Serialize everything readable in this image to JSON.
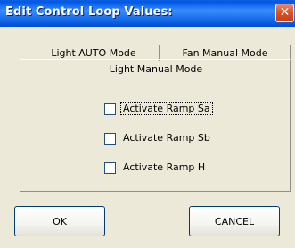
{
  "window": {
    "title": "Edit Control Loop Values:",
    "close_glyph": "✕"
  },
  "tabs": [
    {
      "label": "Light AUTO Mode"
    },
    {
      "label": "Fan Manual Mode"
    }
  ],
  "panel": {
    "title": "Light Manual Mode",
    "checkboxes": [
      {
        "label": "Activate Ramp Sa",
        "checked": false
      },
      {
        "label": "Activate Ramp Sb",
        "checked": false
      },
      {
        "label": "Activate Ramp H",
        "checked": false
      }
    ]
  },
  "buttons": {
    "ok_label": "OK",
    "cancel_label": "CANCEL"
  },
  "icons": {
    "close": "close-icon"
  },
  "colors": {
    "titlebar": "#0a5ee0",
    "dialog_bg": "#ece9d8",
    "close_button": "#d9542a"
  }
}
